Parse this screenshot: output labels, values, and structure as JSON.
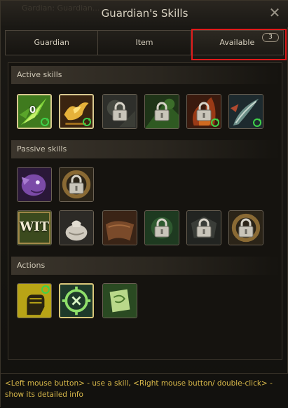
{
  "window": {
    "title": "Guardian's Skills",
    "background_ghost_text": "Gardian: Guardian..."
  },
  "tabs": [
    {
      "label": "Guardian"
    },
    {
      "label": "Item"
    },
    {
      "label": "Available",
      "badge": "3"
    }
  ],
  "sections": {
    "active": {
      "label": "Active skills"
    },
    "passive": {
      "label": "Passive skills"
    },
    "actions": {
      "label": "Actions"
    }
  },
  "active_skills": [
    {
      "icon": "leaf-blade-icon",
      "count": "0",
      "refresh": true,
      "locked": false,
      "active": true
    },
    {
      "icon": "golden-bird-icon",
      "refresh": true,
      "locked": false,
      "active": true
    },
    {
      "icon": "stone-skill-icon",
      "locked": true
    },
    {
      "icon": "green-skill-icon",
      "locked": true
    },
    {
      "icon": "red-fire-skill-icon",
      "locked": true,
      "refresh": true
    },
    {
      "icon": "feather-skill-icon",
      "locked": false,
      "refresh": true
    }
  ],
  "passive_skills_row1": [
    {
      "icon": "purple-creature-icon",
      "locked": false
    },
    {
      "icon": "bronze-ring-icon",
      "locked": true
    }
  ],
  "passive_skills_row2": [
    {
      "icon": "wit-icon",
      "label": "WIT",
      "locked": false
    },
    {
      "icon": "flour-sack-icon",
      "locked": false
    },
    {
      "icon": "brown-cloth-icon",
      "locked": false
    },
    {
      "icon": "green-skill-icon",
      "locked": true
    },
    {
      "icon": "dark-emblem-icon",
      "locked": true
    },
    {
      "icon": "bronze-ring-icon",
      "locked": true
    }
  ],
  "actions": [
    {
      "icon": "raised-fist-icon",
      "refresh": true
    },
    {
      "icon": "cancel-target-icon",
      "selected": true
    },
    {
      "icon": "scroll-icon"
    }
  ],
  "footer": {
    "help_text": "<Left mouse button> - use a skill, <Right mouse button/ double-click> - show its detailed info"
  },
  "colors": {
    "accent_text": "#d8b84a",
    "highlight": "#e01a1a",
    "title": "#d9d2c2"
  }
}
